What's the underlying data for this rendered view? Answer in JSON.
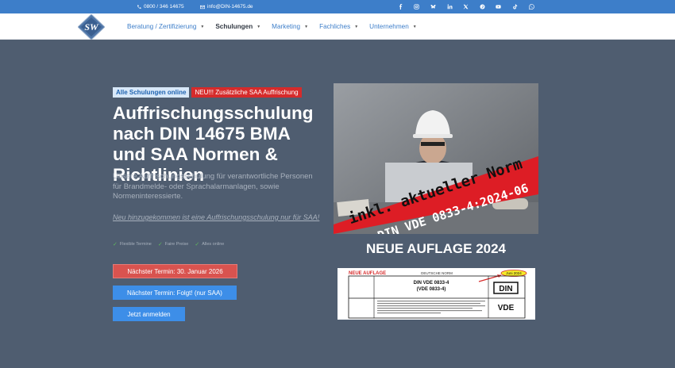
{
  "topbar": {
    "phone": "0800 / 346 14675",
    "email": "info@DIN-14675.de",
    "social_icons": [
      "facebook-icon",
      "instagram-icon",
      "bluesky-icon",
      "linkedin-icon",
      "x-icon",
      "pinterest-icon",
      "youtube-icon",
      "tiktok-icon",
      "whatsapp-icon"
    ]
  },
  "nav": {
    "logo_text": "SW",
    "items": [
      {
        "label": "Beratung / Zertifizierung"
      },
      {
        "label": "Schulungen"
      },
      {
        "label": "Marketing"
      },
      {
        "label": "Fachliches"
      },
      {
        "label": "Unternehmen"
      }
    ]
  },
  "hero": {
    "badge_primary": "Alle Schulungen online",
    "badge_secondary": "NEU!!! Zusätzliche SAA Auffrischung",
    "headline": "Auffrischungsschulung nach DIN 14675 BMA und SAA Normen & Richtlinien",
    "subtext": "Unsere Auffrischungsschulung für verantwortliche Personen für Brandmelde- oder Sprachalarmanlagen, sowie Normeninteressierte.",
    "note_link": "Neu hinzugekommen ist eine Auffrischungsschulung nur für SAA!",
    "features": [
      "Flexible Termine",
      "Faire Preise",
      "Alles online"
    ],
    "btn_next_date": "Nächster Termin: 30. Januar 2026",
    "btn_next_saa": "Nächster Termin: Folgt! (nur SAA)",
    "btn_register": "Jetzt anmelden"
  },
  "promo": {
    "banner_line1": "inkl. aktueller Norm",
    "banner_line2": "DIN VDE 0833-4:2024-06",
    "headline": "NEUE AUFLAGE 2024",
    "doc_label_new": "NEUE AUFLAGE",
    "doc_label_norm": "DEUTSCHE NORM",
    "doc_date": "Juni 2024",
    "doc_title_1": "DIN VDE 0833-4",
    "doc_title_2": "(VDE 0833-4)",
    "doc_din": "DIN",
    "doc_vde": "VDE"
  },
  "colors": {
    "topbar": "#3d7ec9",
    "hero_bg": "#4f5d70",
    "accent_red": "#d62b2b",
    "accent_blue": "#3d8ee8"
  }
}
